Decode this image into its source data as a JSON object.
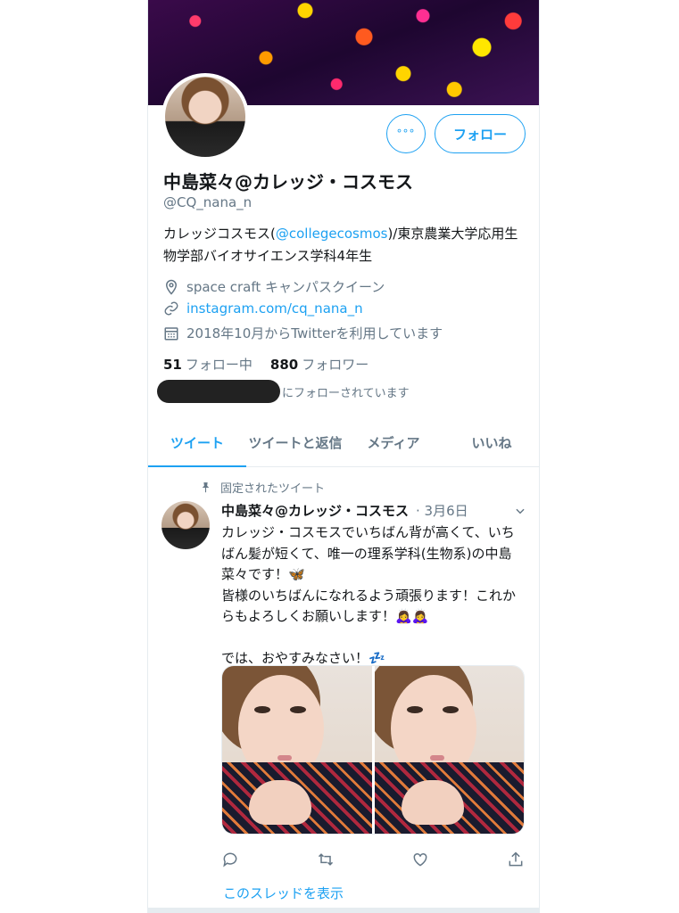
{
  "profile": {
    "name": "中島菜々@カレッジ・コスモス",
    "handle": "@CQ_nana_n",
    "bio_prefix": "カレッジコスモス(",
    "bio_link": "@collegecosmos",
    "bio_suffix": ")/東京農業大学応用生物学部バイオサイエンス学科4年生",
    "location": "space craft キャンパスクイーン",
    "url": "instagram.com/cq_nana_n",
    "joined": "2018年10月からTwitterを利用しています",
    "following_count": "51",
    "following_label": "フォロー中",
    "followers_count": "880",
    "followers_label": "フォロワー",
    "followed_by_suffix": "にフォローされています"
  },
  "buttons": {
    "more": "°°°",
    "follow": "フォロー"
  },
  "tabs": [
    {
      "label": "ツイート",
      "active": true
    },
    {
      "label": "ツイートと返信",
      "active": false
    },
    {
      "label": "メディア",
      "active": false
    },
    {
      "label": "いいね",
      "active": false
    }
  ],
  "tweet": {
    "pinned_label": "固定されたツイート",
    "author": "中島菜々@カレッジ・コスモス",
    "date": "· 3月6日",
    "text_line1": "カレッジ・コスモスでいちばん背が高くて、いちばん髪が短くて、唯一の理系学科(生物系)の中島菜々です！",
    "emoji1": "🦋",
    "text_line2": "\n皆様のいちばんになれるよう頑張ります！これからもよろしくお願いします！",
    "emoji2": "🙇‍♀️🙇‍♀️",
    "text_line3": "\n\nでは、おやすみなさい！",
    "emoji3": "💤",
    "show_thread": "このスレッドを表示"
  },
  "icons": {
    "location": "location-pin-icon",
    "link": "link-icon",
    "calendar": "calendar-icon",
    "pin": "pin-icon",
    "reply": "reply-icon",
    "retweet": "retweet-icon",
    "like": "heart-icon",
    "share": "share-icon",
    "chevron": "chevron-down-icon"
  },
  "colors": {
    "accent": "#1da1f2",
    "secondary_text": "#657786",
    "primary_text": "#14171a"
  }
}
